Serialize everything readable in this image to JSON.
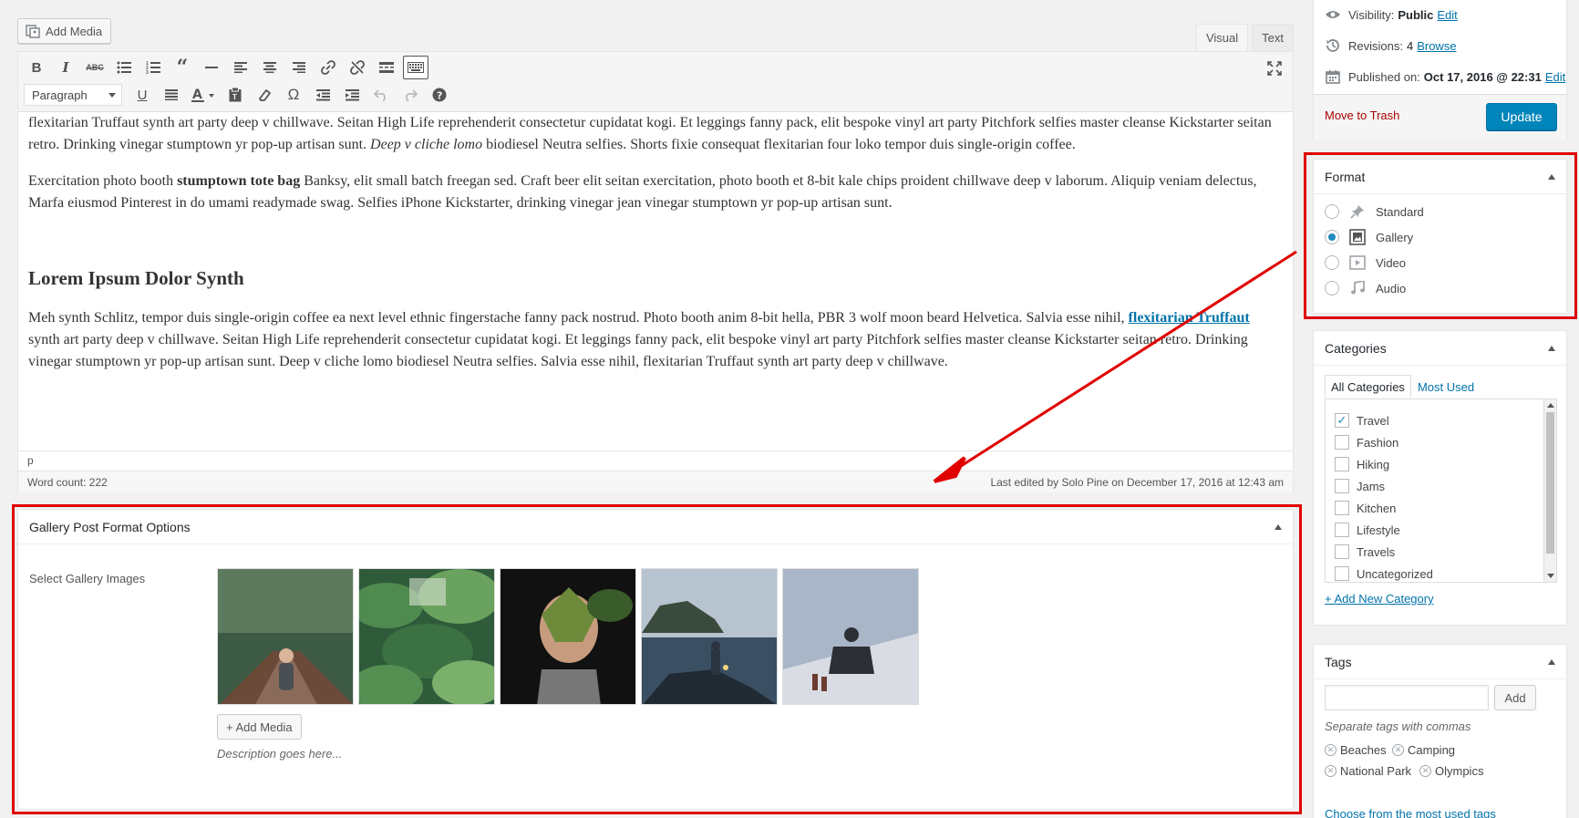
{
  "toolbar": {
    "add_media_label": "Add Media",
    "tab_visual": "Visual",
    "tab_text": "Text",
    "format_select_value": "Paragraph"
  },
  "content": {
    "para1": "flexitarian Truffaut synth art party deep v chillwave. Seitan High Life reprehenderit consectetur cupidatat kogi. Et leggings fanny pack, elit bespoke vinyl art party Pitchfork selfies master cleanse Kickstarter seitan retro. Drinking vinegar stumptown yr pop-up artisan sunt.",
    "para1_italic": "Deep v cliche lomo",
    "para1_end": "biodiesel Neutra selfies. Shorts fixie consequat flexitarian four loko tempor duis single-origin coffee.",
    "para2_start": "Exercitation photo booth",
    "para2_bold": "stumptown tote bag",
    "para2_end": "Banksy, elit small batch freegan sed. Craft beer elit seitan exercitation, photo booth et 8-bit kale chips proident chillwave deep v laborum. Aliquip veniam delectus, Marfa eiusmod Pinterest in do umami readymade swag. Selfies iPhone Kickstarter, drinking vinegar jean vinegar stumptown yr pop-up artisan sunt.",
    "heading": "Lorem Ipsum Dolor Synth",
    "para3_start": "Meh synth Schlitz, tempor duis single-origin coffee ea next level ethnic fingerstache fanny pack nostrud. Photo booth anim 8-bit hella, PBR 3 wolf moon beard Helvetica. Salvia esse nihil,",
    "para3_link": "flexitarian Truffaut",
    "para3_end": "synth art party deep v chillwave. Seitan High Life reprehenderit consectetur cupidatat kogi. Et leggings fanny pack, elit bespoke vinyl art party Pitchfork selfies master cleanse Kickstarter seitan retro. Drinking vinegar stumptown yr pop-up artisan sunt. Deep v cliche lomo biodiesel Neutra selfies. Salvia esse nihil, flexitarian Truffaut synth art party deep v chillwave."
  },
  "status": {
    "path": "p",
    "word_count": "Word count: 222",
    "last_edited": "Last edited by Solo Pine on December 17, 2016 at 12:43 am"
  },
  "gallery": {
    "title": "Gallery Post Format Options",
    "label": "Select Gallery Images",
    "add_media_label": "+ Add Media",
    "description": "Description goes here..."
  },
  "publish": {
    "visibility_label": "Visibility:",
    "visibility_value": "Public",
    "visibility_edit": "Edit",
    "revisions_label": "Revisions:",
    "revisions_value": "4",
    "revisions_browse": "Browse",
    "published_label": "Published on:",
    "published_value": "Oct 17, 2016 @ 22:31",
    "published_edit": "Edit",
    "trash": "Move to Trash",
    "update": "Update"
  },
  "format": {
    "title": "Format",
    "options": [
      {
        "label": "Standard",
        "selected": false
      },
      {
        "label": "Gallery",
        "selected": true
      },
      {
        "label": "Video",
        "selected": false
      },
      {
        "label": "Audio",
        "selected": false
      }
    ]
  },
  "categories": {
    "title": "Categories",
    "tab_all": "All Categories",
    "tab_most": "Most Used",
    "items": [
      {
        "label": "Travel",
        "checked": true
      },
      {
        "label": "Fashion",
        "checked": false
      },
      {
        "label": "Hiking",
        "checked": false
      },
      {
        "label": "Jams",
        "checked": false
      },
      {
        "label": "Kitchen",
        "checked": false
      },
      {
        "label": "Lifestyle",
        "checked": false
      },
      {
        "label": "Travels",
        "checked": false
      },
      {
        "label": "Uncategorized",
        "checked": false
      }
    ],
    "add_new": "+ Add New Category"
  },
  "tags": {
    "title": "Tags",
    "input_value": "",
    "add_label": "Add",
    "hint": "Separate tags with commas",
    "items": [
      "Beaches",
      "Camping",
      "National Park",
      "Olympics"
    ],
    "choose": "Choose from the most used tags"
  },
  "colors": {
    "accent": "#0085ba",
    "link": "#0073aa",
    "annotation": "#e00000",
    "trash": "#a00000"
  }
}
